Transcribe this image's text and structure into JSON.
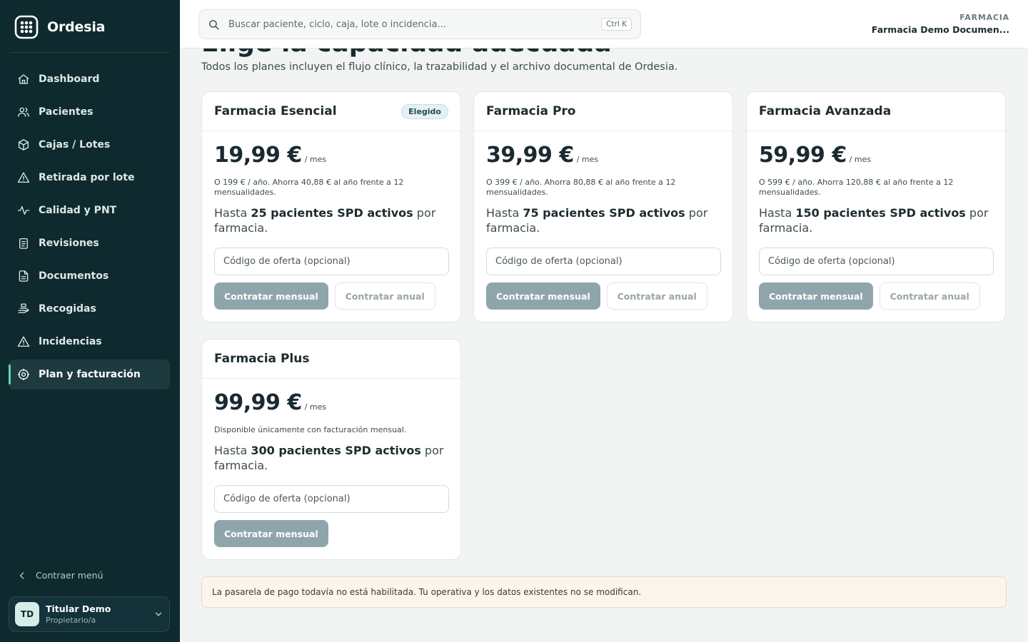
{
  "app": {
    "name": "Ordesia"
  },
  "sidebar": {
    "items": [
      {
        "label": "Dashboard",
        "icon": "home-icon"
      },
      {
        "label": "Pacientes",
        "icon": "users-icon"
      },
      {
        "label": "Cajas / Lotes",
        "icon": "box-icon"
      },
      {
        "label": "Retirada por lote",
        "icon": "warning-icon"
      },
      {
        "label": "Calidad y PNT",
        "icon": "activity-icon"
      },
      {
        "label": "Revisiones",
        "icon": "clipboard-icon"
      },
      {
        "label": "Documentos",
        "icon": "document-icon"
      },
      {
        "label": "Recogidas",
        "icon": "hand-icon"
      },
      {
        "label": "Incidencias",
        "icon": "warning-icon"
      },
      {
        "label": "Plan y facturación",
        "icon": "gear-icon",
        "active": true
      }
    ],
    "collapse_label": "Contraer menú",
    "user": {
      "initials": "TD",
      "name": "Titular Demo",
      "role": "Propietario/a"
    }
  },
  "topbar": {
    "search_placeholder": "Buscar paciente, ciclo, caja, lote o incidencia...",
    "shortcut": "Ctrl K",
    "org_label": "FARMACIA",
    "org_name": "Farmacia Demo Documen..."
  },
  "page": {
    "title": "Elige la capacidad adecuada",
    "subtitle": "Todos los planes incluyen el flujo clínico, la trazabilidad y el archivo documental de Ordesia."
  },
  "plans": [
    {
      "name": "Farmacia Esencial",
      "badge": "Elegido",
      "price": "19,99 €",
      "per": "/ mes",
      "note": "O 199 € / año. Ahorra 40,88 € al año frente a 12 mensualidades.",
      "cap_pre": "Hasta",
      "cap_bold": "25 pacientes SPD activos",
      "cap_post": "por farmacia.",
      "offer_placeholder": "Código de oferta (opcional)",
      "monthly_label": "Contratar mensual",
      "annual_label": "Contratar anual"
    },
    {
      "name": "Farmacia Pro",
      "price": "39,99 €",
      "per": "/ mes",
      "note": "O 399 € / año. Ahorra 80,88 € al año frente a 12 mensualidades.",
      "cap_pre": "Hasta",
      "cap_bold": "75 pacientes SPD activos",
      "cap_post": "por farmacia.",
      "offer_placeholder": "Código de oferta (opcional)",
      "monthly_label": "Contratar mensual",
      "annual_label": "Contratar anual"
    },
    {
      "name": "Farmacia Avanzada",
      "price": "59,99 €",
      "per": "/ mes",
      "note": "O 599 € / año. Ahorra 120,88 € al año frente a 12 mensualidades.",
      "cap_pre": "Hasta",
      "cap_bold": "150 pacientes SPD activos",
      "cap_post": "por farmacia.",
      "offer_placeholder": "Código de oferta (opcional)",
      "monthly_label": "Contratar mensual",
      "annual_label": "Contratar anual"
    },
    {
      "name": "Farmacia Plus",
      "price": "99,99 €",
      "per": "/ mes",
      "note": "Disponible únicamente con facturación mensual.",
      "cap_pre": "Hasta",
      "cap_bold": "300 pacientes SPD activos",
      "cap_post": "por farmacia.",
      "offer_placeholder": "Código de oferta (opcional)",
      "monthly_label": "Contratar mensual"
    }
  ],
  "notice": "La pasarela de pago todavía no está habilitada. Tu operativa y los datos existentes no se modifican."
}
